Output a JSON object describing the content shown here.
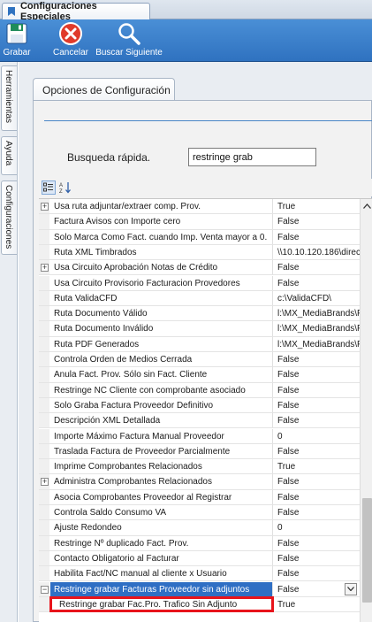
{
  "window": {
    "tab_title": "Configuraciones Especiales"
  },
  "toolbar": {
    "grabar_label": "Grabar",
    "cancelar_label": "Cancelar",
    "buscar_label": "Buscar Siguiente"
  },
  "side_tabs": {
    "herramientas": "Herramientas",
    "ayuda": "Ayuda",
    "configuraciones": "Configuraciones"
  },
  "panel": {
    "tab_label": "Opciones de Configuración",
    "search_label": "Busqueda rápida.",
    "search_value": "restringe grab"
  },
  "grid": {
    "rows": [
      {
        "name": "Usa ruta adjuntar/extraer comp. Prov.",
        "value": "True",
        "expandable": true
      },
      {
        "name": "Factura Avisos con Importe cero",
        "value": "False"
      },
      {
        "name": "Solo Marca Como Fact. cuando Imp. Venta mayor a 0.",
        "value": "False"
      },
      {
        "name": "Ruta XML Timbrados",
        "value": "\\\\10.10.120.186\\direc"
      },
      {
        "name": "Usa Circuito Aprobación Notas de Crédito",
        "value": "False",
        "expandable": true
      },
      {
        "name": "Usa Circuito Provisorio Facturacion Provedores",
        "value": "False"
      },
      {
        "name": "Ruta ValidaCFD",
        "value": "c:\\ValidaCFD\\"
      },
      {
        "name": "Ruta Documento Válido",
        "value": "l:\\MX_MediaBrands\\P"
      },
      {
        "name": "Ruta Documento Inválido",
        "value": "l:\\MX_MediaBrands\\P"
      },
      {
        "name": "Ruta PDF Generados",
        "value": "l:\\MX_MediaBrands\\P"
      },
      {
        "name": "Controla Orden de Medios Cerrada",
        "value": "False"
      },
      {
        "name": "Anula Fact. Prov. Sólo sin Fact. Cliente",
        "value": "False"
      },
      {
        "name": "Restringe NC Cliente con comprobante asociado",
        "value": "False"
      },
      {
        "name": "Solo Graba Factura Proveedor Definitivo",
        "value": "False"
      },
      {
        "name": "Descripción XML Detallada",
        "value": "False"
      },
      {
        "name": "Importe Máximo Factura Manual Proveedor",
        "value": "0"
      },
      {
        "name": "Traslada Factura de Proveedor Parcialmente",
        "value": "False"
      },
      {
        "name": "Imprime Comprobantes Relacionados",
        "value": "True"
      },
      {
        "name": "Administra Comprobantes Relacionados",
        "value": "False",
        "expandable": true
      },
      {
        "name": "Asocia Comprobantes Proveedor al Registrar",
        "value": "False"
      },
      {
        "name": "Controla Saldo Consumo VA",
        "value": "False"
      },
      {
        "name": "Ajuste Redondeo",
        "value": "0"
      },
      {
        "name": "Restringe Nº duplicado Fact. Prov.",
        "value": "False"
      },
      {
        "name": "Contacto Obligatorio al Facturar",
        "value": "False"
      },
      {
        "name": "Habilita Fact/NC manual al cliente x Usuario",
        "value": "False"
      },
      {
        "name": "Restringe grabar Facturas Proveedor sin adjuntos",
        "value": "False",
        "expandable": true,
        "expanded": true,
        "selected": true
      },
      {
        "name": "Restringe grabar Fac.Pro. Trafico Sin Adjunto",
        "value": "True",
        "child": true,
        "highlighted": true
      }
    ]
  },
  "colors": {
    "toolbar": "#2f72c0",
    "selection": "#2f6fc4",
    "highlight_box": "#e8141b"
  }
}
